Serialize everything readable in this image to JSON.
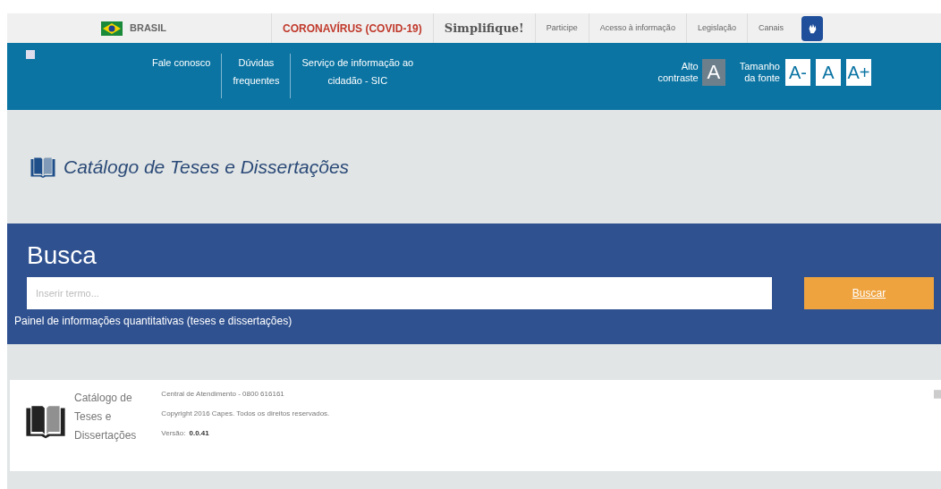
{
  "gov_bar": {
    "country": "BRASIL",
    "links": [
      {
        "label": "CORONAVÍRUS (COVID-19)",
        "kind": "alert"
      },
      {
        "label": "Simplifique!",
        "kind": "strong"
      },
      {
        "label": "Participe",
        "kind": "normal"
      },
      {
        "label": "Acesso à informação",
        "kind": "normal"
      },
      {
        "label": "Legislação",
        "kind": "normal"
      },
      {
        "label": "Canais",
        "kind": "normal"
      }
    ]
  },
  "nav": {
    "links": [
      {
        "lines": [
          "Fale conosco"
        ]
      },
      {
        "lines": [
          "Dúvidas",
          "frequentes"
        ]
      },
      {
        "lines": [
          "Serviço de informação ao",
          "cidadão - SIC"
        ]
      }
    ],
    "contrast_label": [
      "Alto",
      "contraste"
    ],
    "contrast_button": "A",
    "font_label": [
      "Tamanho",
      "da fonte"
    ],
    "font_buttons": [
      "A-",
      "A",
      "A+"
    ]
  },
  "header": {
    "title": "Catálogo de Teses e Dissertações"
  },
  "search": {
    "title": "Busca",
    "placeholder": "Inserir termo...",
    "button": "Buscar",
    "panel_link": "Painel de informações quantitativas (teses e dissertações)"
  },
  "footer": {
    "brand": [
      "Catálogo de",
      "Teses e",
      "Dissertações"
    ],
    "contact": "Central de Atendimento - 0800 616161",
    "copyright": "Copyright 2016 Capes. Todos os direitos reservados.",
    "version_label": "Versão:",
    "version": "0.0.41"
  }
}
